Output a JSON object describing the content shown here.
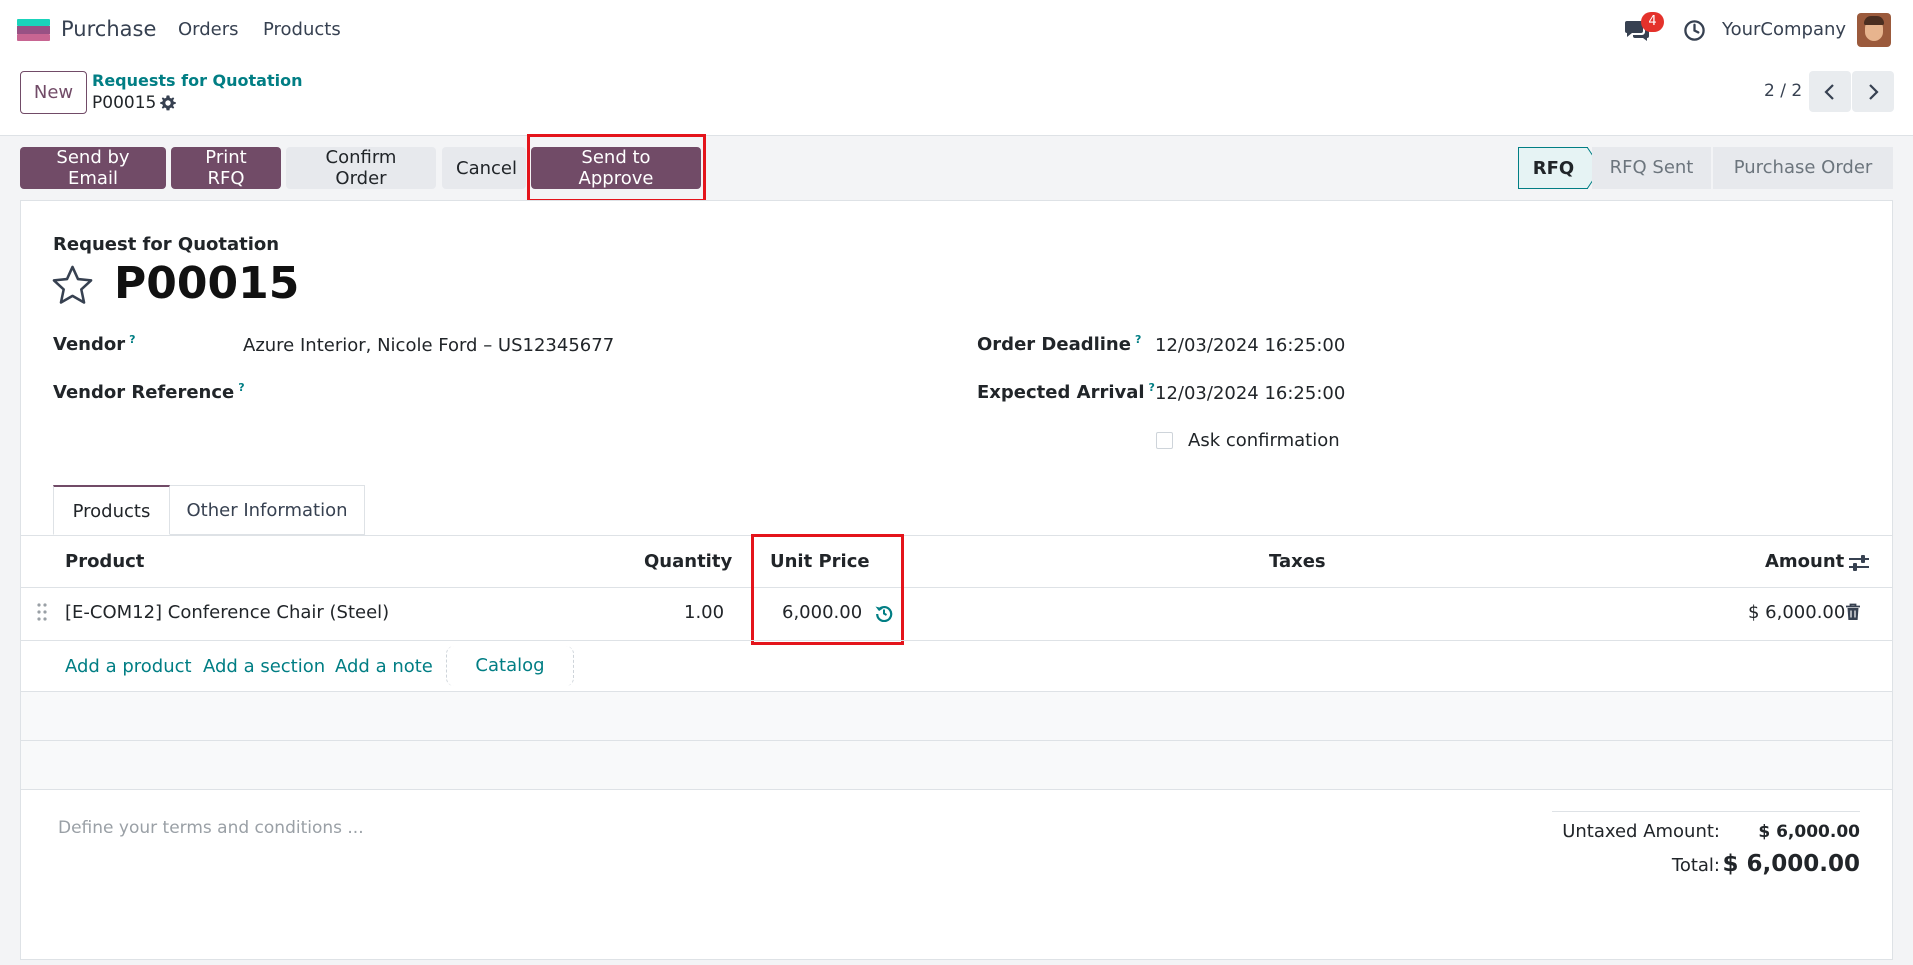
{
  "navbar": {
    "app_name": "Purchase",
    "menu": [
      "Orders",
      "Products"
    ],
    "notification_count": "4",
    "company": "YourCompany"
  },
  "control_panel": {
    "new_label": "New",
    "breadcrumb_parent": "Requests for Quotation",
    "breadcrumb_current": "P00015",
    "pager": "2 / 2"
  },
  "actions": {
    "send_email": "Send by Email",
    "print_rfq": "Print RFQ",
    "confirm_order": "Confirm Order",
    "cancel": "Cancel",
    "send_to_approve": "Send to Approve"
  },
  "statusbar": {
    "stages": [
      "RFQ",
      "RFQ Sent",
      "Purchase Order"
    ],
    "active": "RFQ"
  },
  "form": {
    "doc_label": "Request for Quotation",
    "title": "P00015",
    "vendor_label": "Vendor",
    "vendor_value": "Azure Interior, Nicole Ford – US12345677",
    "vendor_ref_label": "Vendor Reference",
    "order_deadline_label": "Order Deadline",
    "order_deadline_value": "12/03/2024 16:25:00",
    "expected_arrival_label": "Expected Arrival",
    "expected_arrival_value": "12/03/2024 16:25:00",
    "ask_confirmation_label": "Ask confirmation",
    "help_mark": "?"
  },
  "tabs": [
    "Products",
    "Other Information"
  ],
  "lines": {
    "headers": {
      "product": "Product",
      "quantity": "Quantity",
      "unit_price": "Unit Price",
      "taxes": "Taxes",
      "amount": "Amount"
    },
    "rows": [
      {
        "product": "[E-COM12] Conference Chair (Steel)",
        "quantity": "1.00",
        "unit_price": "6,000.00",
        "taxes": "",
        "amount": "$ 6,000.00"
      }
    ],
    "add_product": "Add a product",
    "add_section": "Add a section",
    "add_note": "Add a note",
    "catalog": "Catalog"
  },
  "footer": {
    "terms_placeholder": "Define your terms and conditions ...",
    "untaxed_label": "Untaxed Amount:",
    "untaxed_value": "$ 6,000.00",
    "total_label": "Total:",
    "total_value": "$ 6,000.00"
  },
  "colors": {
    "brand": "#714b67",
    "link": "#017e84",
    "highlight": "#e4141b"
  }
}
